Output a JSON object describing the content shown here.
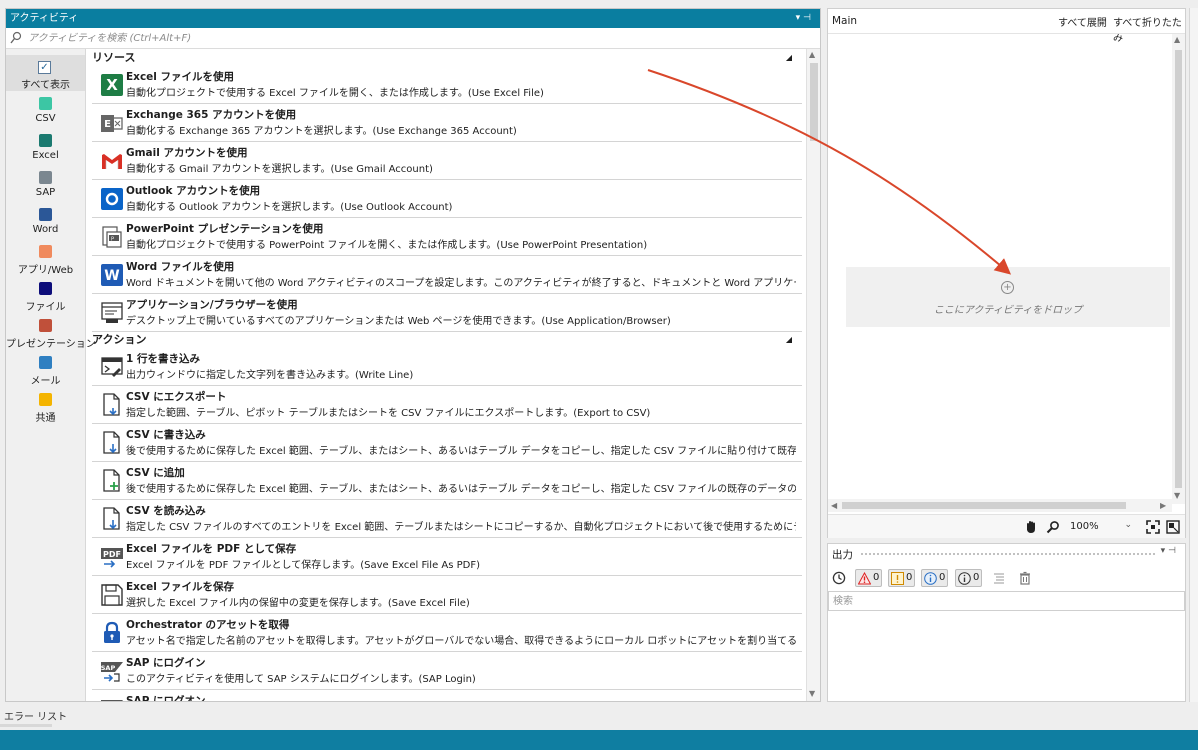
{
  "activities_panel": {
    "title": "アクティビティ",
    "search_placeholder": "アクティビティを検索 (Ctrl+Alt+F)"
  },
  "categories": [
    {
      "label": "すべて表示",
      "color": "",
      "icon": "checkbox-icon"
    },
    {
      "label": "CSV",
      "color": "#3cc6a4"
    },
    {
      "label": "Excel",
      "color": "#1b7a70"
    },
    {
      "label": "SAP",
      "color": "#7b8790"
    },
    {
      "label": "Word",
      "color": "#2b5797"
    },
    {
      "label": "アプリ/Web",
      "color": "#f08a5d"
    },
    {
      "label": "ファイル",
      "color": "#0d0d7a"
    },
    {
      "label": "プレゼンテーション",
      "color": "#c0503a"
    },
    {
      "label": "メール",
      "color": "#2f7fc1"
    },
    {
      "label": "共通",
      "color": "#f4b400"
    }
  ],
  "sections": [
    {
      "label": "リソース"
    },
    {
      "label": "アクション"
    }
  ],
  "activities": [
    {
      "title": "Excel ファイルを使用",
      "desc": "自動化プロジェクトで使用する Excel ファイルを開く、または作成します。(Use Excel File)",
      "icon": "excel-icon"
    },
    {
      "title": "Exchange 365 アカウントを使用",
      "desc": "自動化する Exchange 365 アカウントを選択します。(Use Exchange 365 Account)",
      "icon": "exchange-icon"
    },
    {
      "title": "Gmail アカウントを使用",
      "desc": "自動化する Gmail アカウントを選択します。(Use Gmail Account)",
      "icon": "gmail-icon"
    },
    {
      "title": "Outlook アカウントを使用",
      "desc": "自動化する Outlook アカウントを選択します。(Use Outlook Account)",
      "icon": "outlook-icon"
    },
    {
      "title": "PowerPoint プレゼンテーションを使用",
      "desc": "自動化プロジェクトで使用する PowerPoint ファイルを開く、または作成します。(Use PowerPoint Presentation)",
      "icon": "powerpoint-icon"
    },
    {
      "title": "Word ファイルを使用",
      "desc": "Word ドキュメントを開いて他の Word アクティビティのスコープを設定します。このアクティビティが終了すると、ドキュメントと Word アプリケーションは閉じられます。...",
      "icon": "word-icon"
    },
    {
      "title": "アプリケーション/ブラウザーを使用",
      "desc": "デスクトップ上で開いているすべてのアプリケーションまたは Web ページを使用できます。(Use Application/Browser)",
      "icon": "app-browser-icon"
    },
    {
      "title": "1 行を書き込み",
      "desc": "出力ウィンドウに指定した文字列を書き込みます。(Write Line)",
      "icon": "write-line-icon"
    },
    {
      "title": "CSV にエクスポート",
      "desc": "指定した範囲、テーブル、ピボット テーブルまたはシートを CSV ファイルにエクスポートします。(Export to CSV)",
      "icon": "csv-export-icon"
    },
    {
      "title": "CSV に書き込み",
      "desc": "後で使用するために保存した Excel 範囲、テーブル、またはシート、あるいはテーブル データをコピーし、指定した CSV ファイルに貼り付けて既存のデータを置き換えま...",
      "icon": "csv-write-icon"
    },
    {
      "title": "CSV に追加",
      "desc": "後で使用するために保存した Excel 範囲、テーブル、またはシート、あるいはテーブル データをコピーし、指定した CSV ファイルの既存のデータの後に貼り付けます。(A...",
      "icon": "csv-append-icon"
    },
    {
      "title": "CSV を読み込み",
      "desc": "指定した CSV ファイルのすべてのエントリを Excel 範囲、テーブルまたはシートにコピーするか、自動化プロジェクトにおいて後で使用するためにデータを保存します。(R...",
      "icon": "csv-read-icon"
    },
    {
      "title": "Excel ファイルを PDF として保存",
      "desc": "Excel ファイルを PDF ファイルとして保存します。(Save Excel File As PDF)",
      "icon": "pdf-icon"
    },
    {
      "title": "Excel ファイルを保存",
      "desc": "選択した Excel ファイル内の保留中の変更を保存します。(Save Excel File)",
      "icon": "save-icon"
    },
    {
      "title": "Orchestrator のアセットを取得",
      "desc": "アセット名で指定した名前のアセットを取得します。アセットがグローバルでない場合、取得できるようにローカル ロボットにアセットを割り当てる必要があります。(Get...",
      "icon": "lock-icon"
    },
    {
      "title": "SAP にログイン",
      "desc": "このアクティビティを使用して SAP システムにログインします。(SAP Login)",
      "icon": "sap-icon"
    },
    {
      "title": "SAP にログオン",
      "desc": "",
      "icon": "sap-icon"
    }
  ],
  "designer": {
    "title": "Main",
    "expand_all": "すべて展開",
    "collapse_all": "すべて折りたたみ",
    "drop_text": "ここにアクティビティをドロップ",
    "zoom": "100%"
  },
  "output": {
    "title": "出力",
    "error_count": "0",
    "warning_count": "0",
    "info_count": "0",
    "trace_count": "0",
    "search_placeholder": "検索"
  },
  "footer": {
    "error_list_tab": "エラー リスト"
  },
  "colors": {
    "accent": "#0a7ea0",
    "arrow": "#d9472b"
  }
}
